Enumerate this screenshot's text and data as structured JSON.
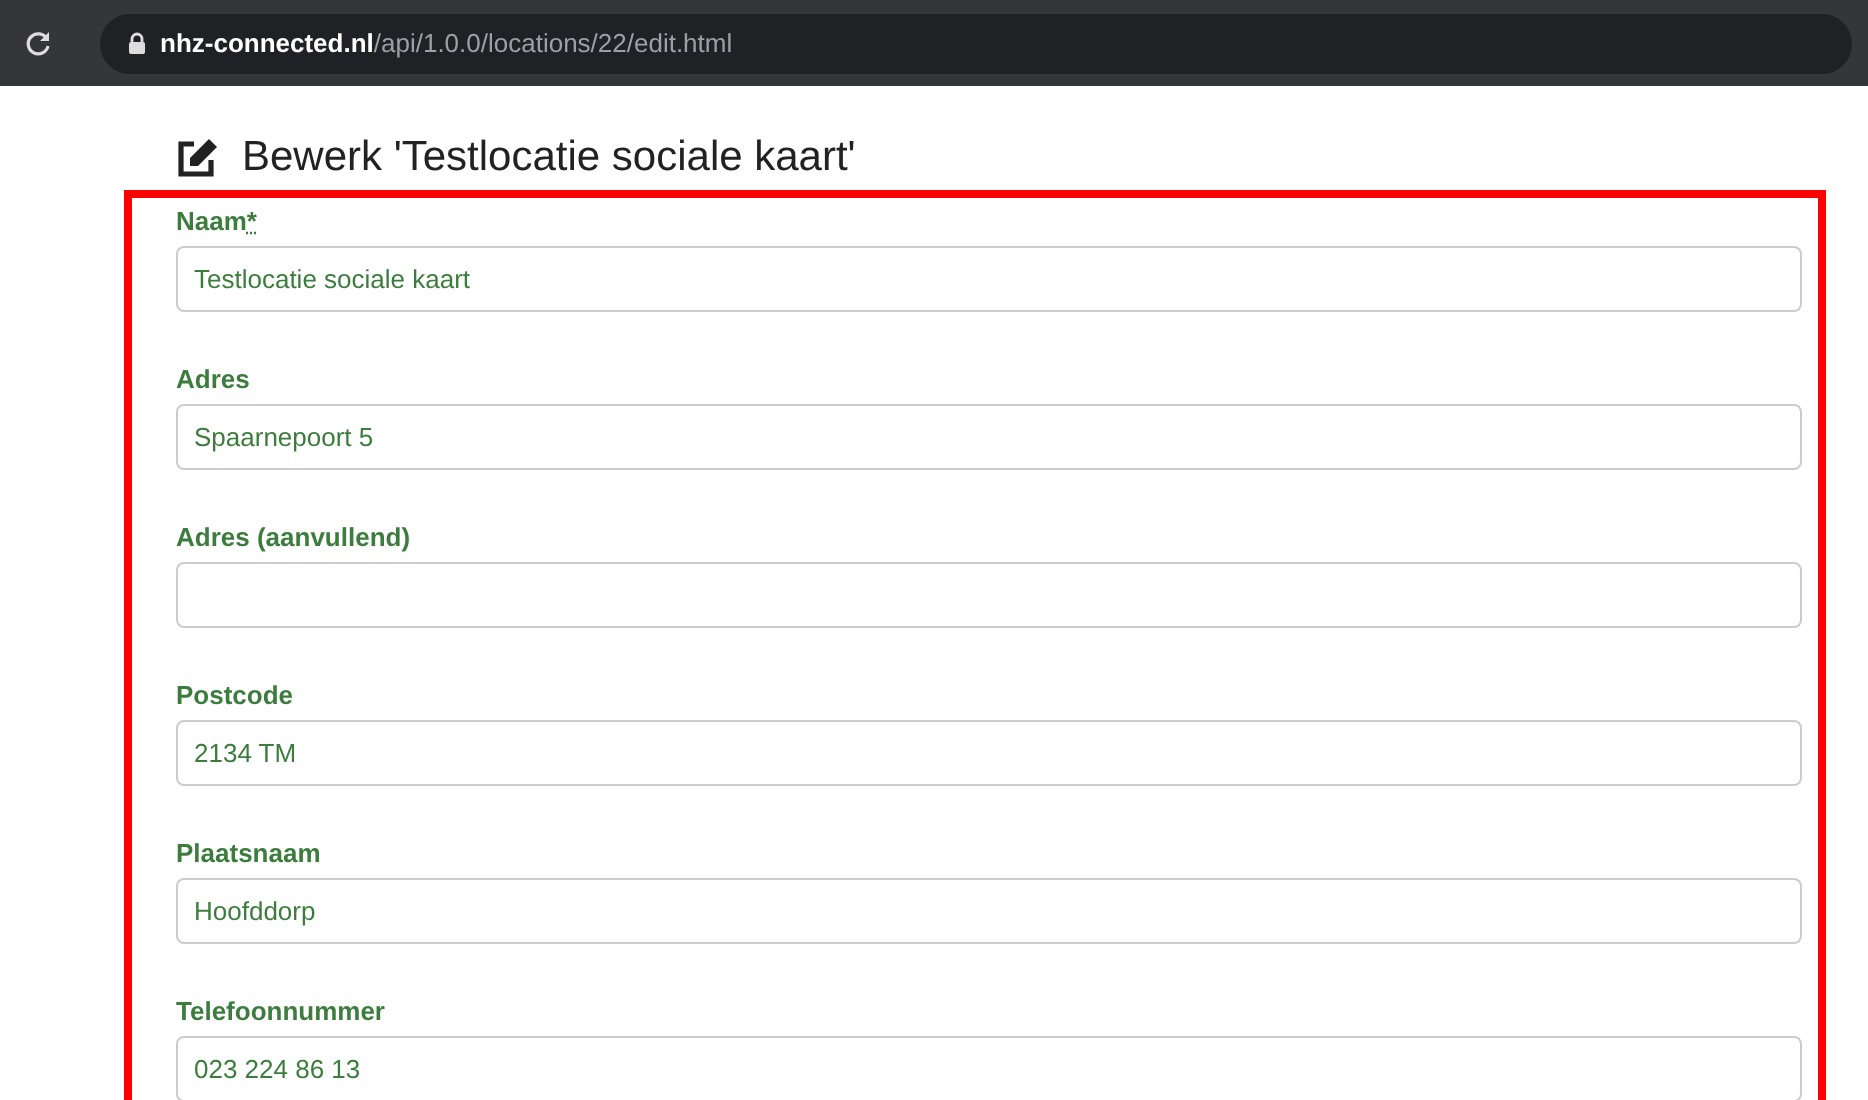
{
  "browser": {
    "domain": "nhz-connected.nl",
    "path": "/api/1.0.0/locations/22/edit.html"
  },
  "page": {
    "title": "Bewerk 'Testlocatie sociale kaart'"
  },
  "fields": [
    {
      "label": "Naam",
      "required_mark": "*",
      "value": "Testlocatie sociale kaart"
    },
    {
      "label": "Adres",
      "value": "Spaarnepoort 5"
    },
    {
      "label": "Adres (aanvullend)"
    },
    {
      "label": "Postcode",
      "value": "2134 TM"
    },
    {
      "label": "Plaatsnaam",
      "value": "Hoofddorp"
    },
    {
      "label": "Telefoonnummer",
      "value": "023 224 86 13"
    }
  ]
}
